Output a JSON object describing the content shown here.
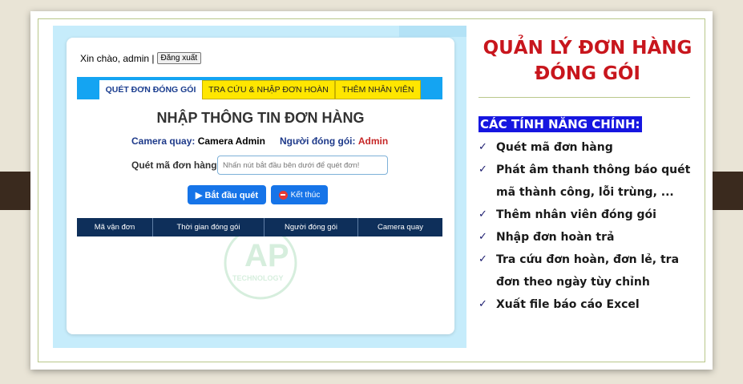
{
  "app": {
    "greeting": "Xin chào, admin |",
    "logout_label": "Đăng xuất",
    "tabs": [
      {
        "label": "QUÉT ĐƠN ĐÓNG GÓI",
        "active": true
      },
      {
        "label": "TRA CỨU & NHẬP ĐƠN HOÀN",
        "active": false
      },
      {
        "label": "THÊM NHÂN VIÊN",
        "active": false
      }
    ],
    "page_title": "NHẬP THÔNG TIN ĐƠN HÀNG",
    "camera_label": "Camera quay:",
    "camera_value": "Camera Admin",
    "packer_label": "Người đóng gói:",
    "packer_value": "Admin",
    "scan_label": "Quét mã đơn hàng",
    "scan_placeholder": "Nhấn nút bắt đầu bên dưới để quét đơn!",
    "start_button": "▶ Bắt đầu quét",
    "stop_button": "Kết thúc",
    "table_headers": [
      "Mã vận đơn",
      "Thời gian đóng gói",
      "Người đóng gói",
      "Camera quay"
    ],
    "watermark_text": "TECHNOLOGY"
  },
  "slide": {
    "title_line1": "QUẢN LÝ ĐƠN HÀNG",
    "title_line2": "ĐÓNG GÓI",
    "features_heading": "CÁC TÍNH NĂNG CHÍNH:",
    "features": [
      "Quét mã đơn hàng",
      "Phát âm thanh thông báo quét mã thành công, lỗi trùng, ...",
      "Thêm nhân viên đóng gói",
      "Nhập đơn hoàn trả",
      "Tra cứu đơn hoàn, đơn lẻ, tra đơn theo ngày tùy chỉnh",
      "Xuất file báo cáo Excel"
    ],
    "check_glyph": "✓"
  },
  "colors": {
    "title_red": "#c8161d",
    "heading_blue": "#1616e0",
    "tab_yellow": "#ffe600",
    "tabbar_blue": "#14a4f2",
    "table_header": "#0e2f5a",
    "button_blue": "#1674e8"
  }
}
